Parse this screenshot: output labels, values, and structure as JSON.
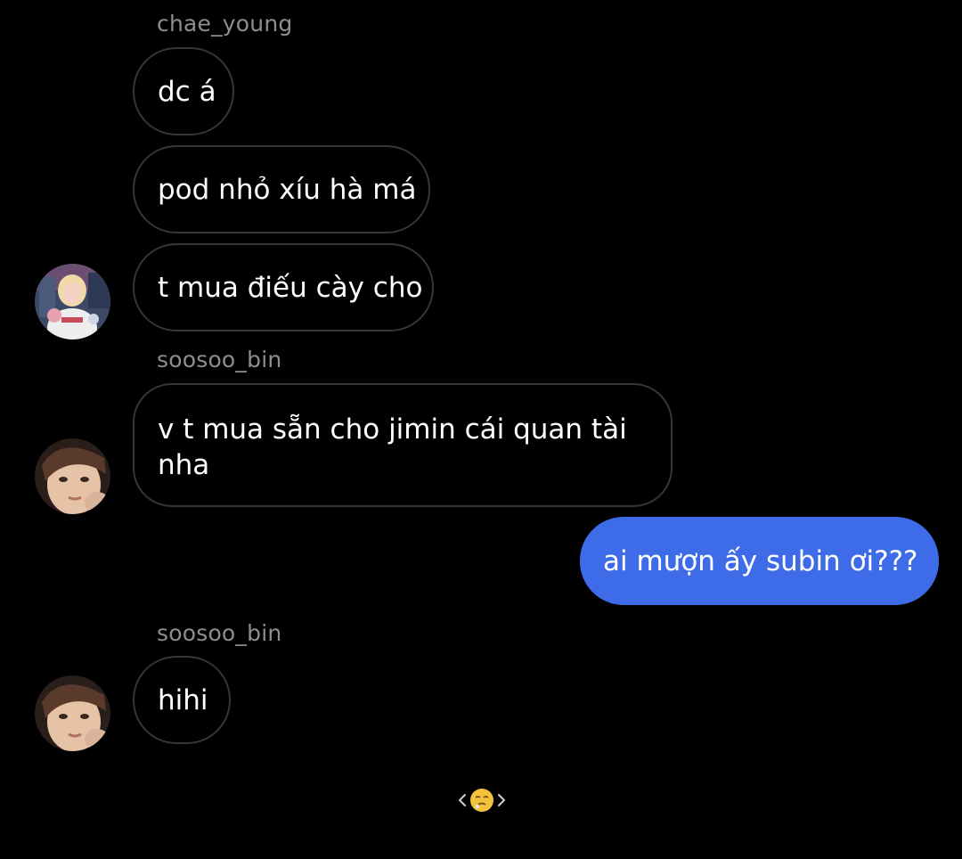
{
  "conversation": {
    "groups": [
      {
        "sender": "chae_young",
        "messages": [
          "dc á",
          "pod nhỏ xíu hà má",
          "t mua điếu cày cho"
        ]
      },
      {
        "sender": "soosoo_bin",
        "messages": [
          "v t mua sẵn cho jimin cái quan tài nha"
        ]
      },
      {
        "sender": "me",
        "messages": [
          "ai mượn ấy subin ơi???"
        ]
      },
      {
        "sender": "soosoo_bin",
        "messages": [
          "hihi"
        ]
      }
    ]
  },
  "composer": {
    "reaction_icon": "tired-face-emoji"
  },
  "colors": {
    "background": "#000000",
    "outgoing_bubble": "#3e6ce8",
    "incoming_border": "#363636",
    "sender_name": "#8e8e8e"
  }
}
